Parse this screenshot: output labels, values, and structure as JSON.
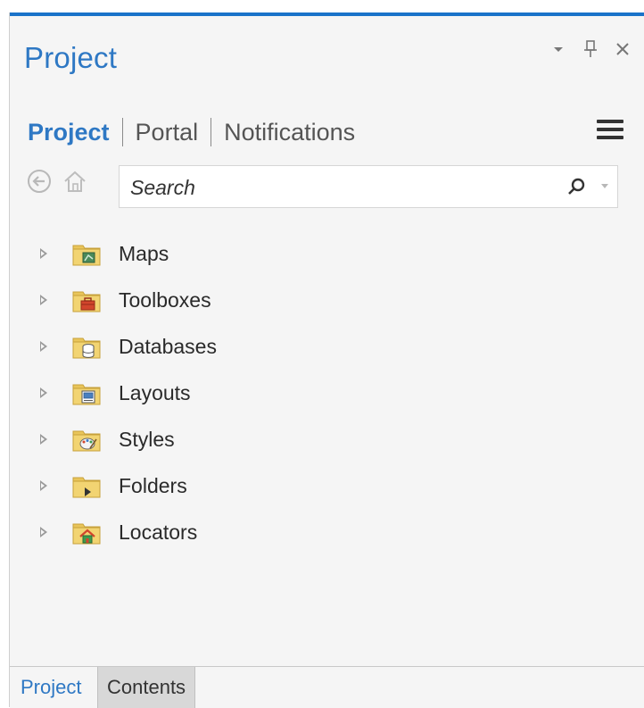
{
  "pane": {
    "title": "Project"
  },
  "tabs": [
    {
      "label": "Project",
      "active": true
    },
    {
      "label": "Portal",
      "active": false
    },
    {
      "label": "Notifications",
      "active": false
    }
  ],
  "search": {
    "placeholder": "Search"
  },
  "tree": {
    "items": [
      {
        "label": "Maps",
        "icon": "maps-folder-icon"
      },
      {
        "label": "Toolboxes",
        "icon": "toolboxes-folder-icon"
      },
      {
        "label": "Databases",
        "icon": "databases-folder-icon"
      },
      {
        "label": "Layouts",
        "icon": "layouts-folder-icon"
      },
      {
        "label": "Styles",
        "icon": "styles-folder-icon"
      },
      {
        "label": "Folders",
        "icon": "folders-folder-icon"
      },
      {
        "label": "Locators",
        "icon": "locators-folder-icon"
      }
    ]
  },
  "bottom_tabs": [
    {
      "label": "Project",
      "active": true
    },
    {
      "label": "Contents",
      "active": false
    }
  ],
  "colors": {
    "accent": "#2e78c4",
    "top_bar": "#1a73c9",
    "folder": "#e8c35a"
  }
}
